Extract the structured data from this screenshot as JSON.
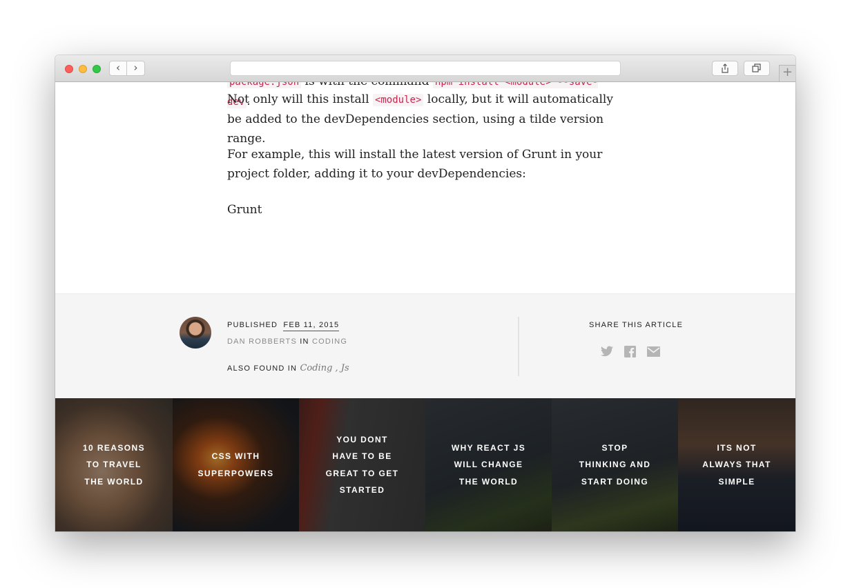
{
  "browser": {
    "back_glyph": "‹",
    "forward_glyph": "›",
    "new_tab_glyph": "+"
  },
  "article": {
    "line_cut": {
      "code_a": "package.json",
      "text_a": " is with the command ",
      "code_b": "npm install <module> --save-dev",
      "text_b": "."
    },
    "p1": {
      "text_a": "Not only will this install ",
      "code": "<module>",
      "text_b": " locally, but it will automatically be added to the devDependencies section, using a tilde version range."
    },
    "p2": "For example, this will install the latest version of Grunt in your project folder, adding it to your devDependencies:",
    "p3": "Grunt"
  },
  "meta": {
    "published_label": "PUBLISHED",
    "published_date": "FEB 11, 2015",
    "author": "DAN ROBBERTS",
    "in_label": "IN",
    "category": "CODING",
    "also_found_label": "ALSO FOUND IN",
    "tags": [
      "Coding",
      "Js"
    ],
    "tag_separator": " , ",
    "share_title": "SHARE THIS ARTICLE"
  },
  "icons": {
    "share": "share-icon",
    "tabs": "tabs-icon",
    "twitter": "twitter-icon",
    "facebook": "facebook-icon",
    "email": "email-icon"
  },
  "related": [
    {
      "title": "10 REASONS TO TRAVEL THE WORLD"
    },
    {
      "title": "CSS WITH SUPERPOWERS"
    },
    {
      "title": "YOU DONT HAVE TO BE GREAT TO GET STARTED"
    },
    {
      "title": "WHY REACT JS WILL CHANGE THE WORLD"
    },
    {
      "title": "STOP THINKING AND START DOING"
    },
    {
      "title": "ITS NOT ALWAYS THAT SIMPLE"
    }
  ],
  "colors": {
    "code_text": "#c7254e",
    "meta_bg": "#f5f5f5",
    "icon_gray": "#b5b5b5"
  }
}
